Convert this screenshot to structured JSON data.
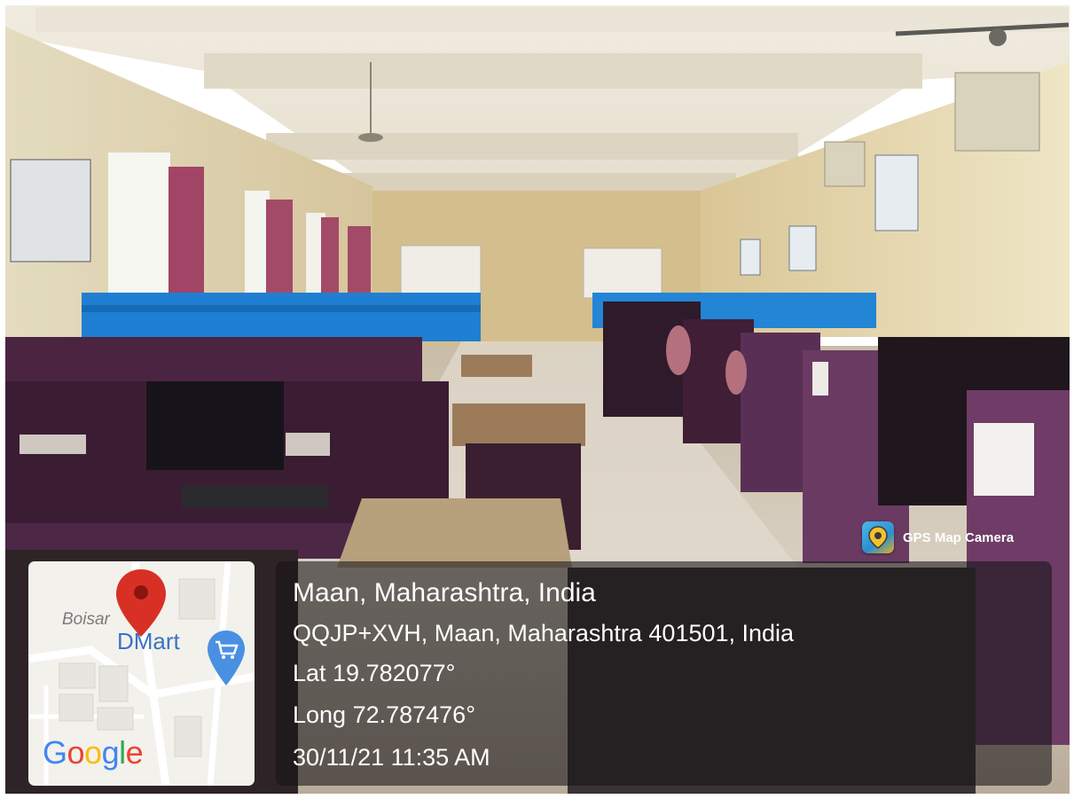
{
  "badge": {
    "app_name": "GPS Map Camera",
    "icon": "map-pin-app-icon"
  },
  "location": {
    "place": "Maan, Maharashtra, India",
    "address": "QQJP+XVH, Maan, Maharashtra 401501, India",
    "latitude": "Lat 19.782077°",
    "longitude": "Long 72.787476°",
    "datetime": "30/11/21 11:35 AM"
  },
  "map": {
    "area_label": "Boisar",
    "store_label": "DMart",
    "logo_text": "Google",
    "pin_color": "#d93025",
    "store_icon": "shopping-cart-icon"
  },
  "colors": {
    "wall": "#e8dcb8",
    "desk": "#3e1f38",
    "partition": "#1e7fd0",
    "floor": "#cfc3b3"
  }
}
